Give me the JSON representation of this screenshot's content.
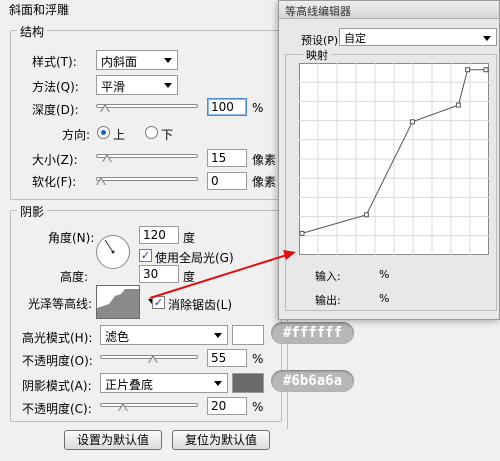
{
  "panel": {
    "bevel_title": "斜面和浮雕",
    "structure": {
      "title": "结构",
      "style_label": "样式(T):",
      "style_value": "内斜面",
      "technique_label": "方法(Q):",
      "technique_value": "平滑",
      "depth_label": "深度(D):",
      "depth_value": "100",
      "depth_unit": "%",
      "depth_slider": 0.04,
      "direction_label": "方向:",
      "direction_up": "上",
      "direction_down": "下",
      "size_label": "大小(Z):",
      "size_value": "15",
      "size_unit": "像素",
      "size_slider": 0.06,
      "soften_label": "软化(F):",
      "soften_value": "0",
      "soften_unit": "像素",
      "soften_slider": 0.0
    },
    "shading": {
      "title": "阴影",
      "angle_label": "角度(N):",
      "angle_value": "120",
      "angle_unit": "度",
      "global_light_label": "使用全局光(G)",
      "altitude_label": "高度:",
      "altitude_value": "30",
      "altitude_unit": "度",
      "gloss_label": "光泽等高线:",
      "antialias_label": "消除锯齿(L)",
      "highlight_mode_label": "高光模式(H):",
      "highlight_mode_value": "滤色",
      "highlight_color": "#ffffff",
      "highlight_hex_tag": "#ffffff",
      "highlight_opacity_label": "不透明度(O):",
      "highlight_opacity_value": "55",
      "highlight_opacity_unit": "%",
      "highlight_opacity_slider": 0.55,
      "shadow_mode_label": "阴影模式(A):",
      "shadow_mode_value": "正片叠底",
      "shadow_color": "#6b6a6a",
      "shadow_hex_tag": "#6b6a6a",
      "shadow_opacity_label": "不透明度(C):",
      "shadow_opacity_value": "20",
      "shadow_opacity_unit": "%",
      "shadow_opacity_slider": 0.2
    },
    "make_default_button": "设置为默认值",
    "reset_default_button": "复位为默认值"
  },
  "contour_editor": {
    "title": "等高线编辑器",
    "preset_label": "预设(P):",
    "preset_value": "自定",
    "mapping_label": "映射",
    "input_label": "输入:",
    "input_unit": "%",
    "output_label": "输出:",
    "output_unit": "%",
    "curve_points": [
      [
        0,
        0.1
      ],
      [
        0.35,
        0.2
      ],
      [
        0.6,
        0.7
      ],
      [
        0.85,
        0.79
      ],
      [
        0.9,
        0.98
      ],
      [
        1.0,
        0.98
      ]
    ]
  },
  "colors": {
    "arrow": "#e01010",
    "accent": "#1f5fbf"
  }
}
